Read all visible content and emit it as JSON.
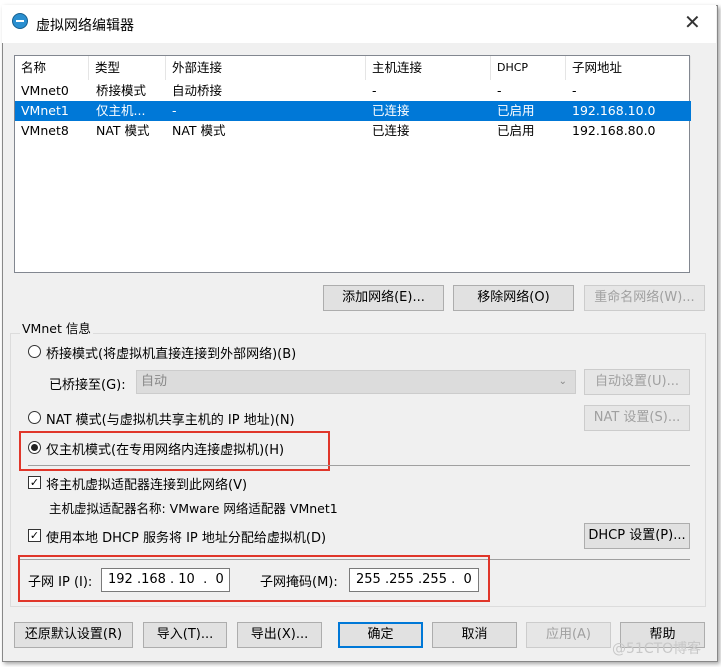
{
  "title": "虚拟网络编辑器",
  "table": {
    "headers": [
      "名称",
      "类型",
      "外部连接",
      "主机连接",
      "DHCP",
      "子网地址"
    ],
    "rows": [
      [
        "VMnet0",
        "桥接模式",
        "自动桥接",
        "-",
        "-",
        "-"
      ],
      [
        "VMnet1",
        "仅主机...",
        "-",
        "已连接",
        "已启用",
        "192.168.10.0"
      ],
      [
        "VMnet8",
        "NAT 模式",
        "NAT 模式",
        "已连接",
        "已启用",
        "192.168.80.0"
      ]
    ],
    "selected_row": 1
  },
  "list_buttons": {
    "add": "添加网络(E)...",
    "remove": "移除网络(O)",
    "rename": "重命名网络(W)..."
  },
  "info": {
    "group_label": "VMnet 信息",
    "bridged": "桥接模式(将虚拟机直接连接到外部网络)(B)",
    "bridged_to_label": "已桥接至(G):",
    "bridged_to_value": "自动",
    "auto_settings": "自动设置(U)...",
    "nat": "NAT 模式(与虚拟机共享主机的 IP 地址)(N)",
    "nat_settings": "NAT 设置(S)...",
    "host_only": "仅主机模式(在专用网络内连接虚拟机)(H)",
    "connect_adapter": "将主机虚拟适配器连接到此网络(V)",
    "adapter_name": "主机虚拟适配器名称: VMware 网络适配器 VMnet1",
    "use_dhcp": "使用本地 DHCP 服务将 IP 地址分配给虚拟机(D)",
    "dhcp_settings": "DHCP 设置(P)...",
    "subnet_ip_label": "子网 IP (I):",
    "subnet_ip": "192 .168 . 10  .  0",
    "subnet_mask_label": "子网掩码(M):",
    "subnet_mask": "255 .255 .255 .  0"
  },
  "footer": {
    "restore": "还原默认设置(R)",
    "import": "导入(T)...",
    "export": "导出(X)...",
    "ok": "确定",
    "cancel": "取消",
    "apply": "应用(A)",
    "help": "帮助"
  },
  "watermark": "@51CTO博客"
}
